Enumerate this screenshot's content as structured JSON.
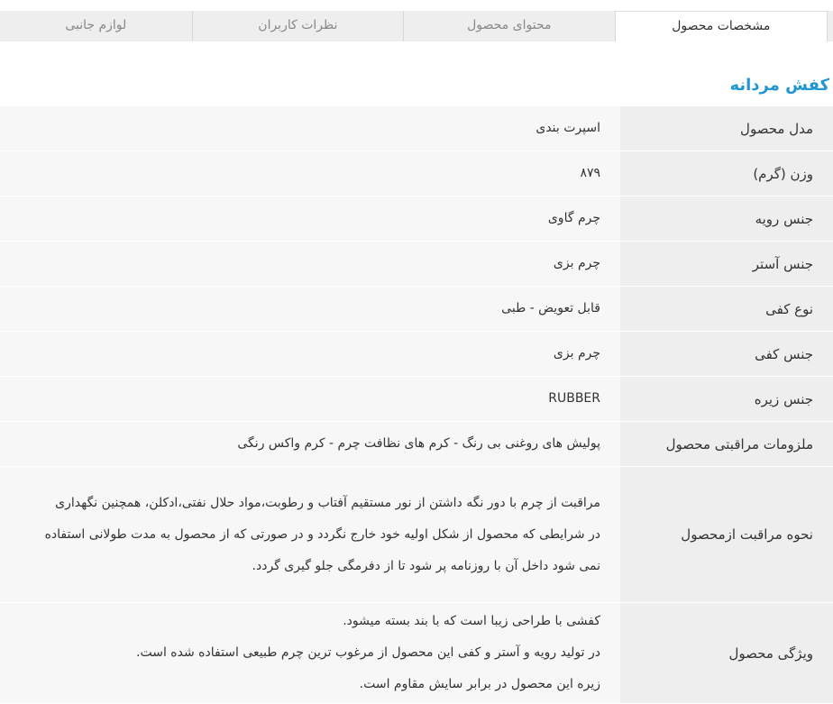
{
  "tabs": [
    {
      "label": "مشخصات محصول",
      "active": true
    },
    {
      "label": "محتوای محصول",
      "active": false
    },
    {
      "label": "نظرات کاربران",
      "active": false
    },
    {
      "label": "لوازم جانبی",
      "active": false
    }
  ],
  "product_title": "کفش مردانه",
  "specs": [
    {
      "key": "مدل محصول",
      "value": "اسپرت بندی"
    },
    {
      "key": "وزن (گرم)",
      "value": "۸۷۹"
    },
    {
      "key": "جنس رویه",
      "value": "چرم گاوی"
    },
    {
      "key": "جنس آستر",
      "value": "چرم بزی"
    },
    {
      "key": "نوع کفی",
      "value": "قابل تعویض - طبی"
    },
    {
      "key": "جنس کفی",
      "value": "چرم بزی"
    },
    {
      "key": "جنس زیره",
      "value": "RUBBER"
    },
    {
      "key": "ملزومات مراقبتی محصول",
      "value": "پولیش های روغنی بی رنگ - کرم های نظافت چرم - کرم واکس رنگی"
    },
    {
      "key": "نحوه مراقبت ازمحصول",
      "lines": [
        "مراقبت از چرم با دور نگه داشتن از نور مستقیم آفتاب و رطوبت،مواد حلال نفتی،ادکلن، همچنین نگهداری",
        "در شرایطی که محصول از شکل اولیه خود خارج نگردد و در صورتی که از محصول به مدت طولانی استفاده",
        "نمی شود داخل آن با روزنامه پر شود تا از دفرمگی جلو گیری گردد."
      ]
    },
    {
      "key": "ویژگی محصول",
      "lines": [
        "کفشی با طراحی زیبا است که با بند بسته میشود.",
        "در تولید رویه و آستر و کفی این محصول از مرغوب ترین چرم طبیعی استفاده شده است.",
        "زیره این محصول در برابر سایش مقاوم است."
      ]
    }
  ]
}
